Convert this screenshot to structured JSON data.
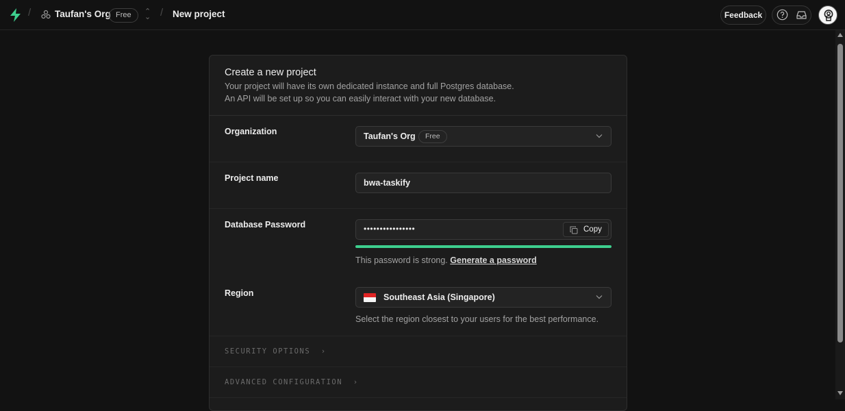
{
  "topbar": {
    "org_name": "Taufan's Org",
    "org_plan_badge": "Free",
    "page_title": "New project",
    "feedback_label": "Feedback"
  },
  "card": {
    "title": "Create a new project",
    "description_line1": "Your project will have its own dedicated instance and full Postgres database.",
    "description_line2": "An API will be set up so you can easily interact with your new database."
  },
  "form": {
    "organization": {
      "label": "Organization",
      "value": "Taufan's Org",
      "badge": "Free"
    },
    "project_name": {
      "label": "Project name",
      "value": "bwa-taskify"
    },
    "database_password": {
      "label": "Database Password",
      "value_masked": "••••••••••••••••",
      "copy_label": "Copy",
      "strength": 1.0,
      "strength_color": "#3ecf8e",
      "hint_text": "This password is strong.",
      "generate_link": "Generate a password"
    },
    "region": {
      "label": "Region",
      "value": "Southeast Asia (Singapore)",
      "flag_icon": "singapore-flag-icon",
      "hint_text": "Select the region closest to your users for the best performance."
    }
  },
  "sections": {
    "security_options": "SECURITY OPTIONS",
    "advanced_configuration": "ADVANCED CONFIGURATION"
  },
  "colors": {
    "accent": "#3ecf8e",
    "background": "#121212",
    "card": "#1c1c1c"
  }
}
